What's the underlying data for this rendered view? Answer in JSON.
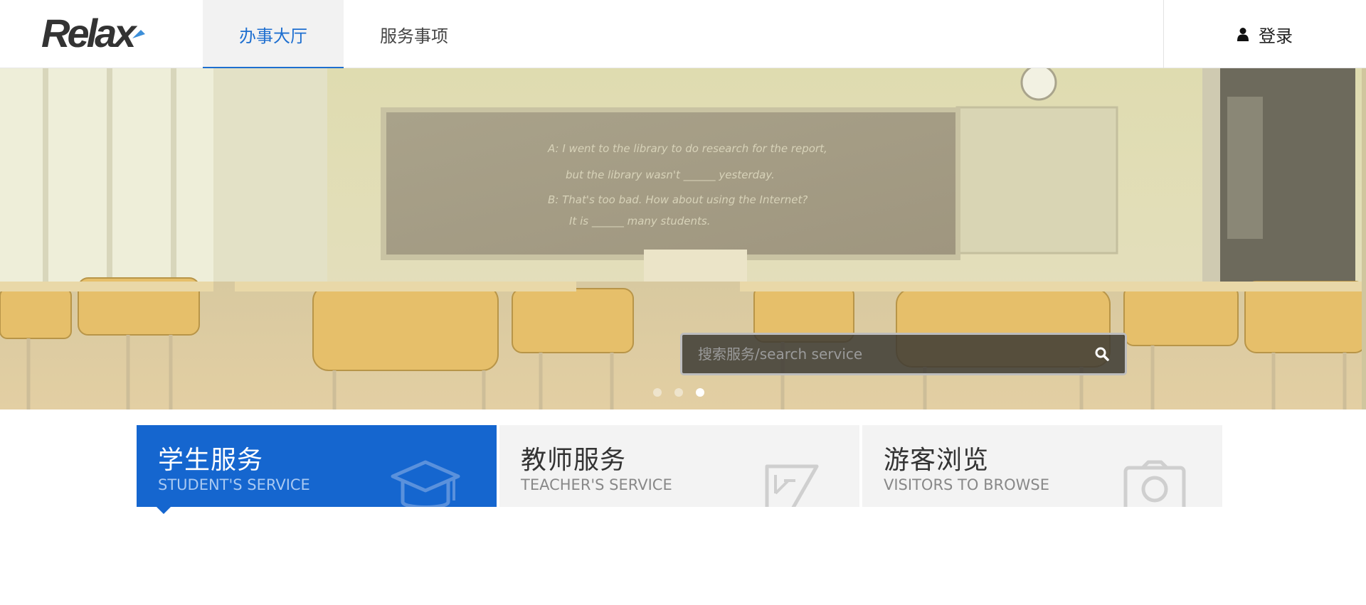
{
  "header": {
    "logo_text": "Relax",
    "nav_tabs": [
      {
        "label": "办事大厅",
        "active": true
      },
      {
        "label": "服务事项",
        "active": false
      }
    ],
    "login_label": "登录",
    "login_icon": "user-icon"
  },
  "banner": {
    "search": {
      "placeholder": "搜索服务/search service",
      "value": "",
      "icon": "search-icon"
    },
    "carousel": {
      "slides": 3,
      "active_index": 2
    },
    "chalkboard_lines": [
      "A: I went to the library to do research for the report,",
      "but the library wasn't ______ yesterday.",
      "B: That's too bad. How about using the Internet?",
      "It is ______ many students."
    ]
  },
  "services": [
    {
      "title": "学生服务",
      "subtitle": "STUDENT'S SERVICE",
      "icon": "graduation-cap-icon",
      "active": true
    },
    {
      "title": "教师服务",
      "subtitle": "TEACHER'S SERVICE",
      "icon": "ruler-pencil-icon",
      "active": false
    },
    {
      "title": "游客浏览",
      "subtitle": "VISITORS TO BROWSE",
      "icon": "camera-icon",
      "active": false
    }
  ],
  "colors": {
    "accent": "#1e6fd0",
    "card_active": "#1566cf",
    "card_inactive": "#f3f3f3"
  }
}
